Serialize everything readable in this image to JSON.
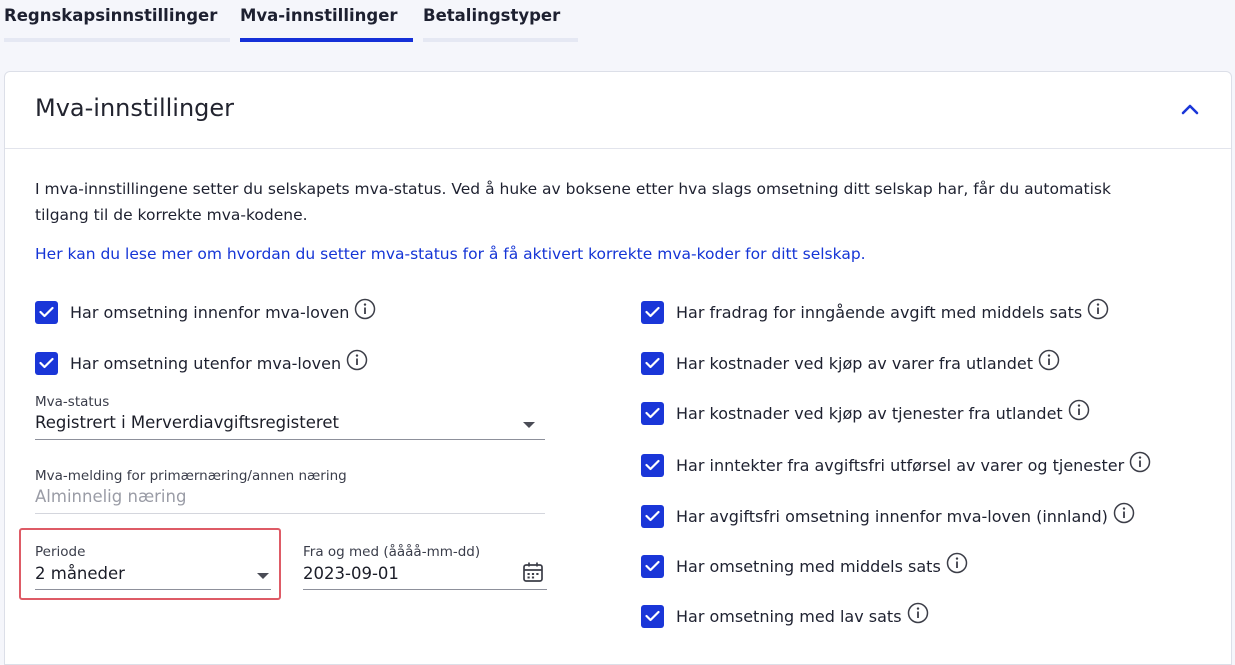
{
  "tabs": [
    {
      "label": "Regnskapsinnstillinger",
      "active": false
    },
    {
      "label": "Mva-innstillinger",
      "active": true
    },
    {
      "label": "Betalingstyper",
      "active": false
    }
  ],
  "card": {
    "title": "Mva-innstillinger",
    "collapse_icon": "chevron-up-icon",
    "intro": "I mva-innstillingene setter du selskapets mva-status. Ved å huke av boksene etter hva slags omsetning ditt selskap har, får du automatisk tilgang til de korrekte mva-kodene.",
    "link": "Her kan du lese mer om hvordan du setter mva-status for å få aktivert korrekte mva-koder for ditt selskap."
  },
  "left_checkboxes": [
    {
      "label": "Har omsetning innenfor mva-loven",
      "checked": true
    },
    {
      "label": "Har omsetning utenfor mva-loven",
      "checked": true
    }
  ],
  "mva_status": {
    "label": "Mva-status",
    "value": "Registrert i Merverdiavgiftsregisteret"
  },
  "mva_melding": {
    "label": "Mva-melding for primærnæring/annen næring",
    "value": "Alminnelig næring"
  },
  "periode": {
    "label": "Periode",
    "value": "2 måneder"
  },
  "fra_og_med": {
    "label": "Fra og med (åååå-mm-dd)",
    "value": "2023-09-01",
    "icon": "calendar-icon"
  },
  "right_checkboxes": [
    {
      "label": "Har fradrag for inngående avgift med middels sats",
      "checked": true
    },
    {
      "label": "Har kostnader ved kjøp av varer fra utlandet",
      "checked": true
    },
    {
      "label": "Har kostnader ved kjøp av tjenester fra utlandet",
      "checked": true
    },
    {
      "label": "Har inntekter fra avgiftsfri utførsel av varer og tjenester",
      "checked": true
    },
    {
      "label": "Har avgiftsfri omsetning innenfor mva-loven (innland)",
      "checked": true
    },
    {
      "label": "Har omsetning med middels sats",
      "checked": true
    },
    {
      "label": "Har omsetning med lav sats",
      "checked": true
    }
  ],
  "colors": {
    "accent": "#1a36d8",
    "highlight": "#de5b66",
    "link": "#1535d6"
  }
}
